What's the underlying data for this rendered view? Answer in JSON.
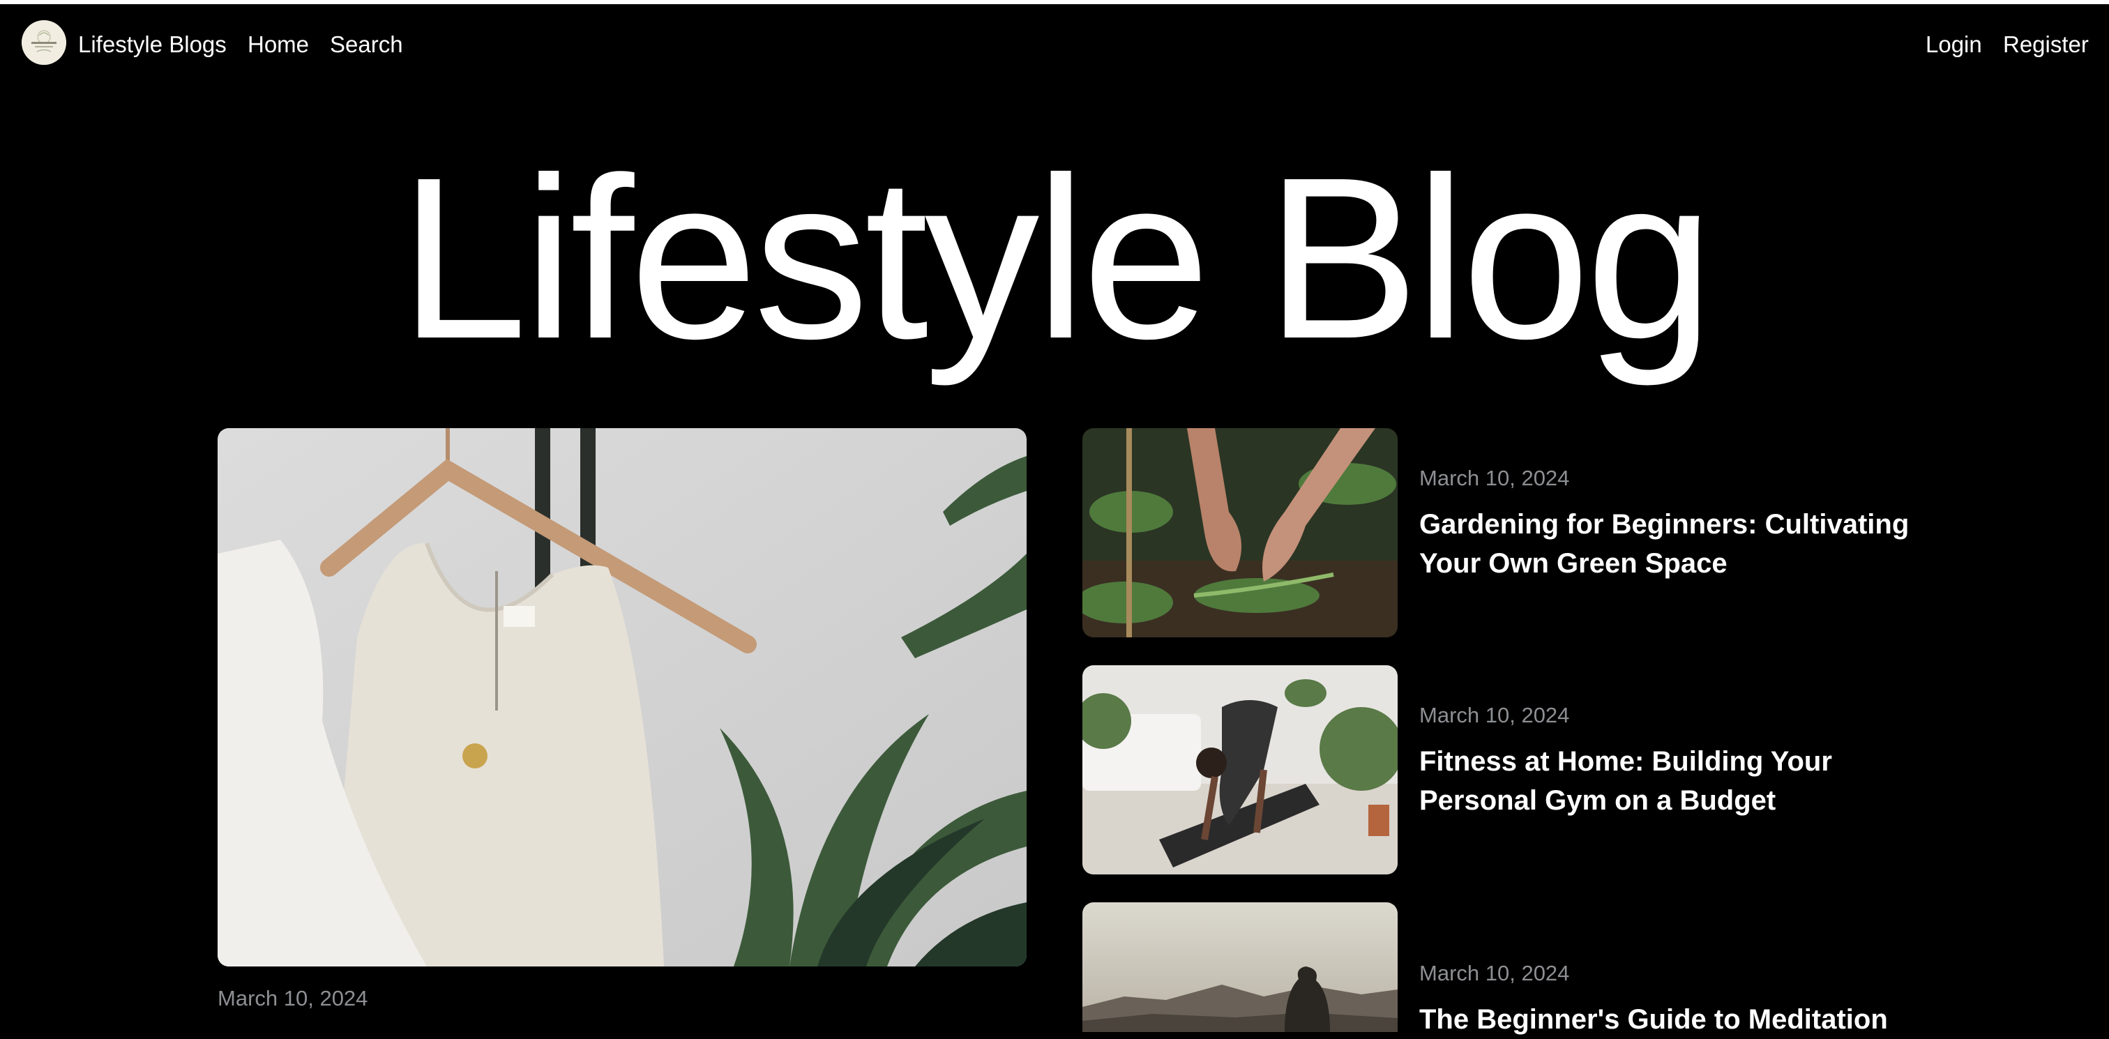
{
  "nav": {
    "brand": "Lifestyle Blogs",
    "home": "Home",
    "search": "Search",
    "login": "Login",
    "register": "Register",
    "logo_icon": "lifestyle-blogs-logo"
  },
  "hero": {
    "title": "Lifestyle Blog"
  },
  "featured": {
    "date": "March 10, 2024",
    "image": "linen-top-on-hanger-with-plants"
  },
  "posts": [
    {
      "date": "March 10, 2024",
      "title": "Gardening for Beginners: Cultivating Your Own Green Space",
      "image": "hands-planting-seedlings"
    },
    {
      "date": "March 10, 2024",
      "title": "Fitness at Home: Building Your Personal Gym on a Budget",
      "image": "person-on-yoga-mat"
    },
    {
      "date": "March 10, 2024",
      "title": "The Beginner's Guide to Meditation",
      "image": "person-facing-mountains"
    }
  ],
  "colors": {
    "background": "#000000",
    "text": "#ffffff",
    "muted": "#8d8f93"
  }
}
